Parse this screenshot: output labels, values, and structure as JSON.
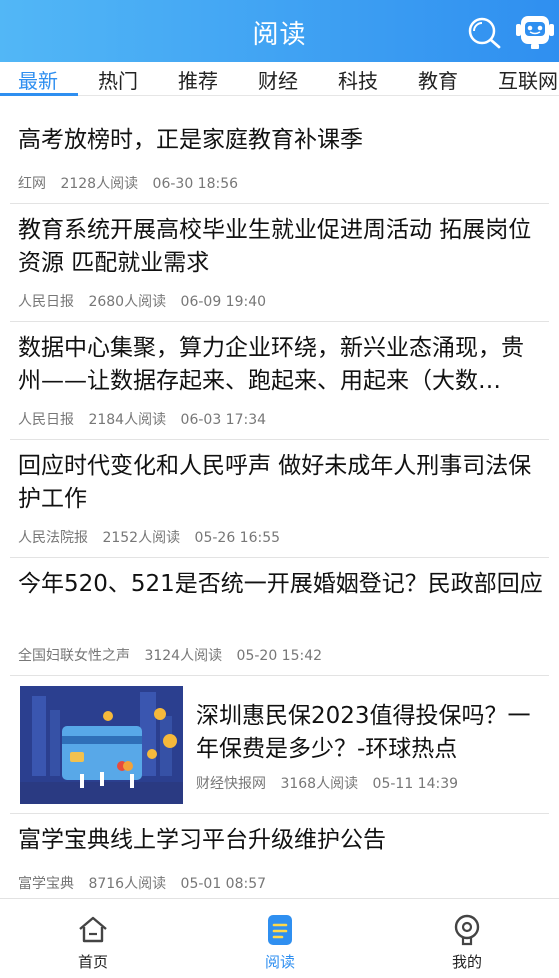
{
  "header": {
    "title": "阅读",
    "search_icon": "search-icon",
    "assistant_icon": "robot-assistant-icon"
  },
  "tabs": [
    {
      "label": "最新",
      "active": true
    },
    {
      "label": "热门",
      "active": false
    },
    {
      "label": "推荐",
      "active": false
    },
    {
      "label": "财经",
      "active": false
    },
    {
      "label": "科技",
      "active": false
    },
    {
      "label": "教育",
      "active": false
    },
    {
      "label": "互联网",
      "active": false
    }
  ],
  "articles": [
    {
      "title": "高考放榜时，正是家庭教育补课季",
      "source": "红网",
      "reads": "2128人阅读",
      "time": "06-30 18:56"
    },
    {
      "title": "教育系统开展高校毕业生就业促进周活动 拓展岗位资源 匹配就业需求",
      "source": "人民日报",
      "reads": "2680人阅读",
      "time": "06-09 19:40"
    },
    {
      "title": "数据中心集聚，算力企业环绕，新兴业态涌现，贵州——让数据存起来、跑起来、用起来（大数…",
      "source": "人民日报",
      "reads": "2184人阅读",
      "time": "06-03 17:34"
    },
    {
      "title": "回应时代变化和人民呼声 做好未成年人刑事司法保护工作",
      "source": "人民法院报",
      "reads": "2152人阅读",
      "time": "05-26 16:55"
    },
    {
      "title": "今年520、521是否统一开展婚姻登记？民政部回应",
      "source": "全国妇联女性之声",
      "reads": "3124人阅读",
      "time": "05-20 15:42"
    },
    {
      "title": "深圳惠民保2023值得投保吗？一年保费是多少？-环球热点",
      "source": "财经快报网",
      "reads": "3168人阅读",
      "time": "05-11 14:39",
      "thumbnail": "credit-card-illustration"
    },
    {
      "title": "富学宝典线上学习平台升级维护公告",
      "source": "富学宝典",
      "reads": "8716人阅读",
      "time": "05-01 08:57"
    }
  ],
  "bottom_nav": [
    {
      "label": "首页",
      "icon": "home-icon",
      "active": false
    },
    {
      "label": "阅读",
      "icon": "reading-icon",
      "active": true
    },
    {
      "label": "我的",
      "icon": "profile-icon",
      "active": false
    }
  ],
  "colors": {
    "accent": "#2f8ff0",
    "header_gradient_start": "#52b7f6",
    "meta_text": "#777777",
    "divider": "#e3e3e3"
  }
}
